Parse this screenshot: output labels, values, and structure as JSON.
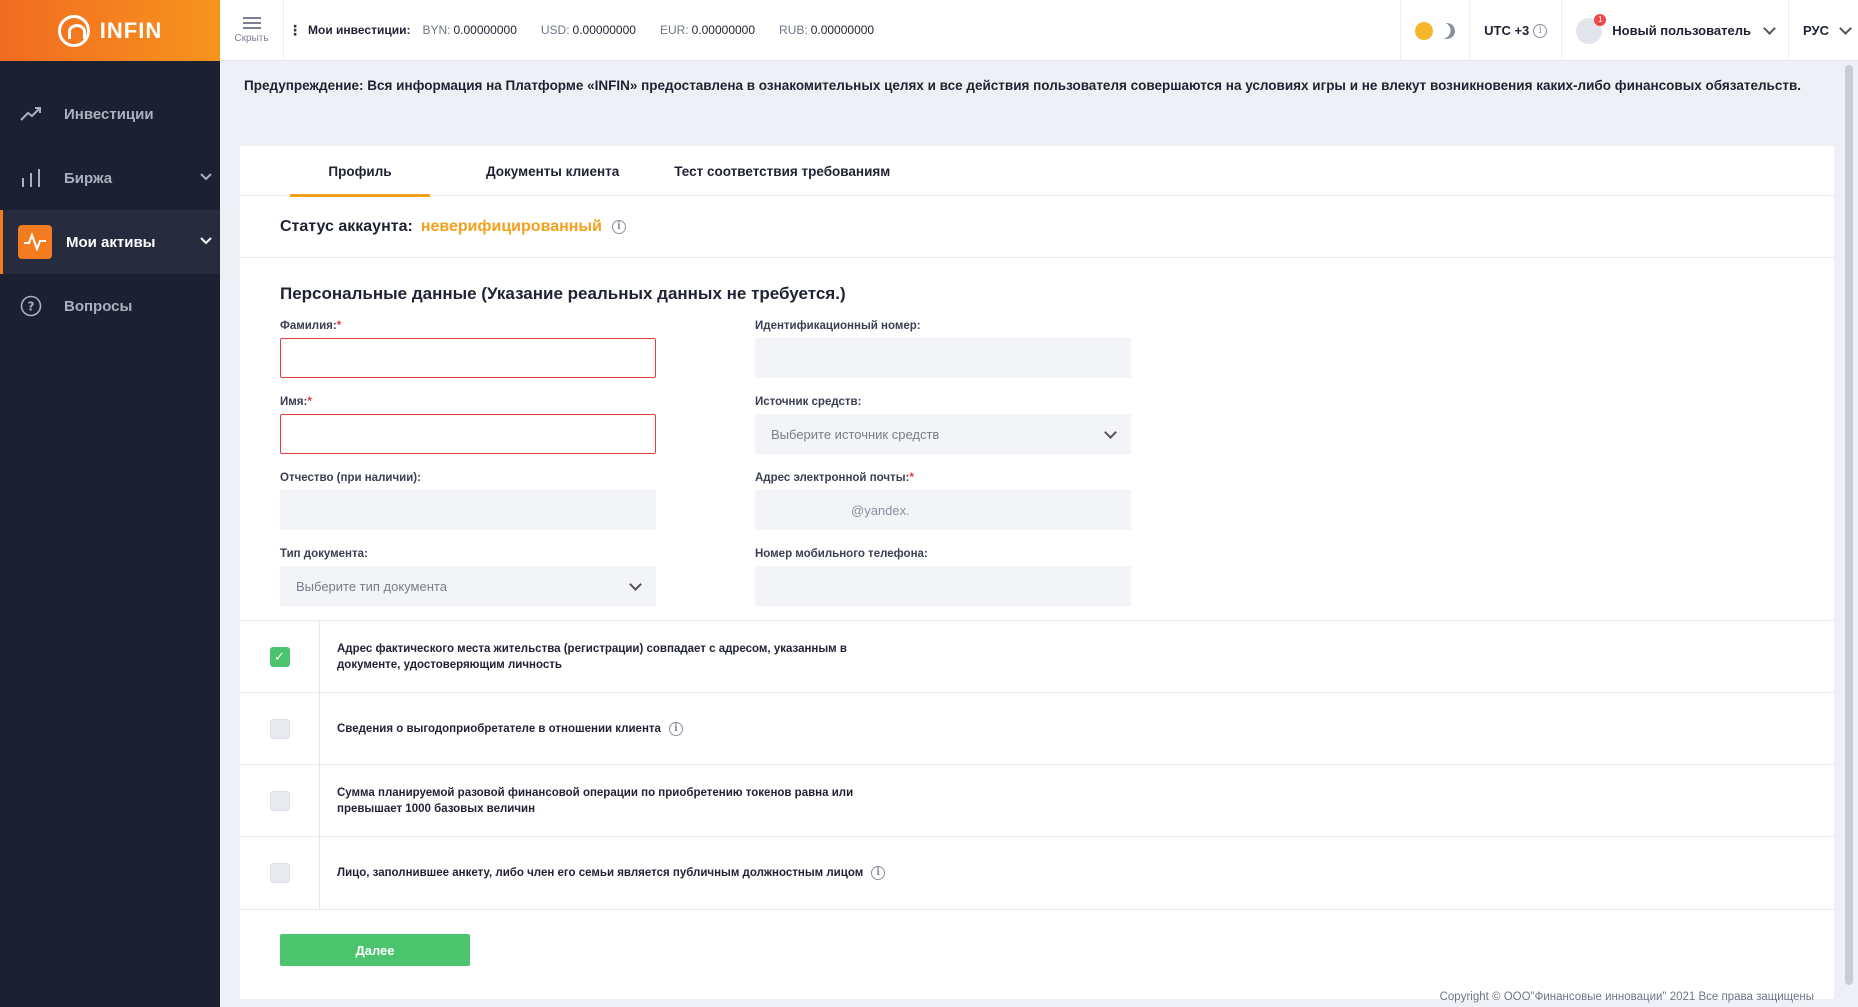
{
  "brand": {
    "name": "INFIN"
  },
  "topbar": {
    "hide_label": "Скрыть",
    "investments_title": "Мои инвестиции:",
    "balances": [
      {
        "code": "BYN:",
        "value": "0.00000000"
      },
      {
        "code": "USD:",
        "value": "0.00000000"
      },
      {
        "code": "EUR:",
        "value": "0.00000000"
      },
      {
        "code": "RUB:",
        "value": "0.00000000"
      }
    ],
    "timezone": "UTC +3",
    "notification_count": "1",
    "user_name": "Новый пользователь",
    "language": "РУС"
  },
  "sidebar": {
    "items": [
      {
        "label": "Инвестиции",
        "icon": "trend-up-icon"
      },
      {
        "label": "Биржа",
        "icon": "bar-chart-icon"
      },
      {
        "label": "Мои активы",
        "icon": "pulse-icon",
        "active": true
      },
      {
        "label": "Вопросы",
        "icon": "question-circle-icon"
      }
    ]
  },
  "warning": "Предупреждение: Вся информация на Платформе «INFIN» предоставлена в ознакомительных целях и все действия пользователя совершаются на условиях игры и не влекут возникновения каких-либо финансовых обязательств.",
  "tabs": [
    "Профиль",
    "Документы клиента",
    "Тест соответствия требованиям"
  ],
  "status": {
    "label": "Статус аккаунта:",
    "value": "неверифицированный"
  },
  "personal_title": "Персональные данные (Указание реальных данных не требуется.)",
  "form": {
    "surname_label": "Фамилия:",
    "name_label": "Имя:",
    "patronymic_label": "Отчество (при наличии):",
    "doc_type_label": "Тип документа:",
    "doc_type_placeholder": "Выберите тип документа",
    "id_number_label": "Идентификационный номер:",
    "funds_source_label": "Источник средств:",
    "funds_source_placeholder": "Выберите источник средств",
    "email_label": "Адрес электронной почты:",
    "email_value": "@yandex.",
    "phone_label": "Номер мобильного телефона:",
    "required_mark": "*"
  },
  "checks": [
    {
      "text": "Адрес фактического места жительства (регистрации) совпадает с адресом, указанным в документе, удостоверяющим личность",
      "checked": true,
      "info": false
    },
    {
      "text": "Сведения о выгодоприобретателе в отношении клиента",
      "checked": false,
      "info": true
    },
    {
      "text": "Сумма планируемой разовой финансовой операции по приобретению токенов равна или превышает 1000 базовых величин",
      "checked": false,
      "info": false
    },
    {
      "text": "Лицо, заполнившее анкету, либо член его семьи является публичным должностным лицом",
      "checked": false,
      "info": true
    }
  ],
  "next_button": "Далее",
  "copyright": "Copyright © ООО\"Финансовые инновации\" 2021 Все права защищены",
  "colors": {
    "accent": "#f47c20",
    "status": "#f4a01c",
    "success": "#4bc46d",
    "error": "#e53b3b",
    "sidebar": "#1c2131"
  }
}
